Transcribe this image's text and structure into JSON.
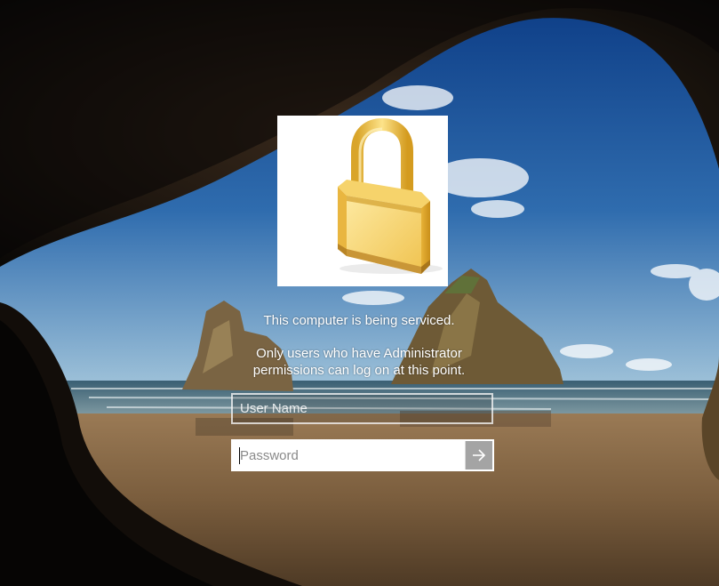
{
  "message": {
    "line1": "This computer is being serviced.",
    "line2a": "Only users who have Administrator",
    "line2b": "permissions can log on at this point."
  },
  "login": {
    "username_placeholder": "User Name",
    "username_value": "",
    "password_placeholder": "Password",
    "password_value": ""
  },
  "icons": {
    "lock": "padlock-icon",
    "submit": "arrow-right-icon"
  },
  "colors": {
    "tile_background": "#ffffff",
    "lock_gold": "#f2c64a",
    "text": "#ffffff"
  }
}
